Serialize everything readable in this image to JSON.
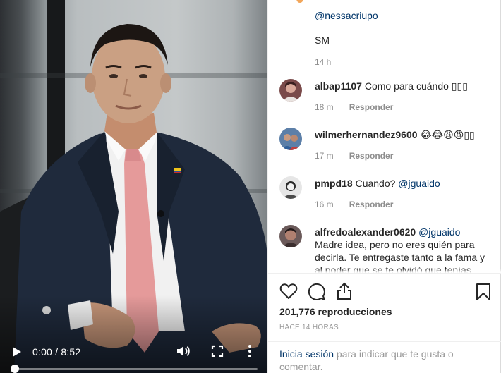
{
  "video": {
    "time": "0:00 / 8:52",
    "progress": 0.0,
    "icons": [
      "play-icon",
      "volume-icon",
      "fullscreen-icon",
      "more-options-icon"
    ]
  },
  "comments": {
    "previous_reply": {
      "mention": "@nessacriupo",
      "text": "SM",
      "time": "14 h"
    },
    "reply_label": "Responder",
    "items": [
      {
        "username": "albap1107",
        "text": "Como para cuándo ▯▯▯",
        "time": "18 m"
      },
      {
        "username": "wilmerhernandez9600",
        "text": "😂😂😩😩▯▯",
        "time": "17 m"
      },
      {
        "username": "pmpd18",
        "text": "Cuando? ",
        "mention": "@jguaido",
        "time": "16 m"
      },
      {
        "username": "alfredoalexander0620",
        "mention": "@jguaido",
        "text": "Madre idea, pero no eres quién para decirla. Te entregaste tanto a la fama y al poder que se te olvidó que tenías"
      }
    ]
  },
  "actions": {
    "views": "201,776 reproducciones",
    "posted": "HACE 14 HORAS",
    "login_link": "Inicia sesión",
    "login_text": " para indicar que te gusta o comentar.",
    "icons": [
      "heart-icon",
      "comment-icon",
      "share-icon",
      "bookmark-icon"
    ]
  },
  "colors": {
    "link": "#003569",
    "meta": "#8e8e8e",
    "text": "#262626",
    "tie": "#e59a9a",
    "suit": "#1f2a3c"
  }
}
